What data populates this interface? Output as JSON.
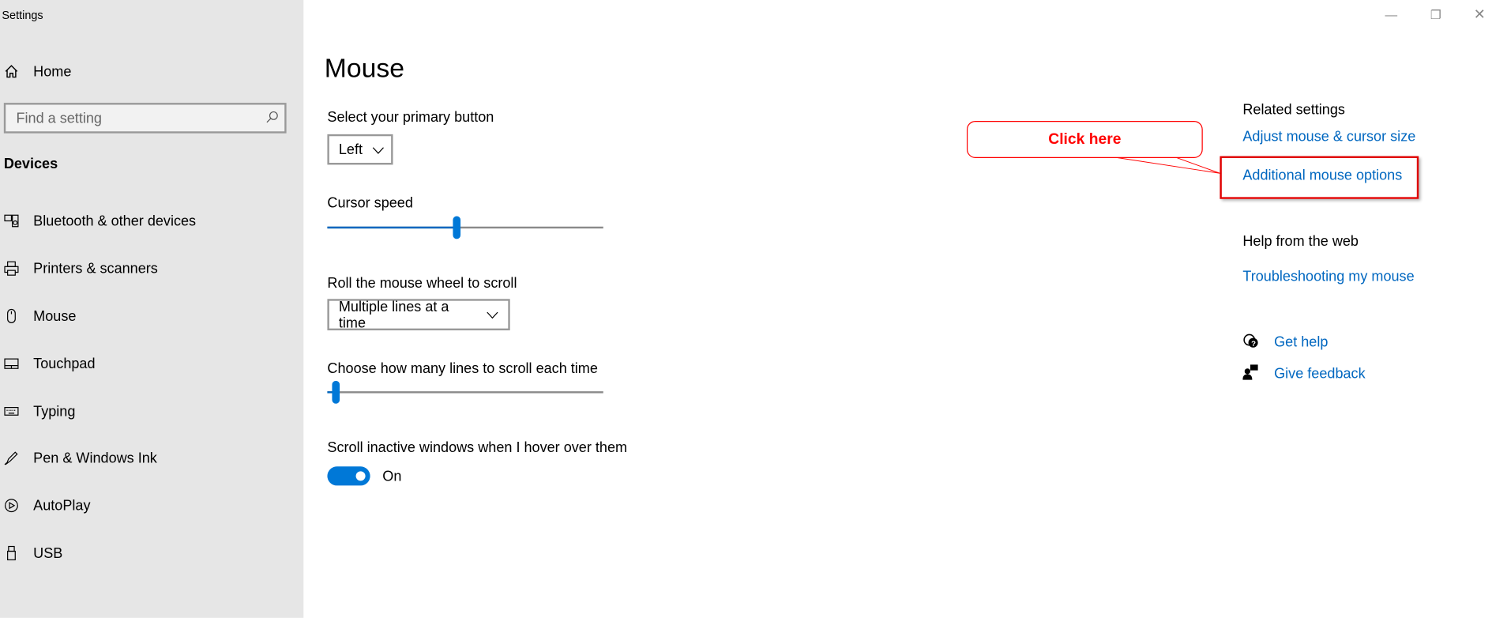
{
  "window": {
    "title": "Settings",
    "controls": [
      "minimize",
      "restore",
      "close"
    ]
  },
  "sidebar": {
    "home_label": "Home",
    "search_placeholder": "Find a setting",
    "section": "Devices",
    "items": [
      {
        "label": "Bluetooth & other devices",
        "icon": "bluetooth-devices-icon"
      },
      {
        "label": "Printers & scanners",
        "icon": "printer-icon"
      },
      {
        "label": "Mouse",
        "icon": "mouse-icon"
      },
      {
        "label": "Touchpad",
        "icon": "touchpad-icon"
      },
      {
        "label": "Typing",
        "icon": "keyboard-icon"
      },
      {
        "label": "Pen & Windows Ink",
        "icon": "pen-icon"
      },
      {
        "label": "AutoPlay",
        "icon": "autoplay-icon"
      },
      {
        "label": "USB",
        "icon": "usb-icon"
      }
    ]
  },
  "main": {
    "title": "Mouse",
    "primary_button": {
      "label": "Select your primary button",
      "value": "Left"
    },
    "cursor_speed": {
      "label": "Cursor speed",
      "fraction": 0.47
    },
    "wheel": {
      "label": "Roll the mouse wheel to scroll",
      "value": "Multiple lines at a time"
    },
    "lines": {
      "label": "Choose how many lines to scroll each time",
      "fraction": 0.03
    },
    "inactive": {
      "label": "Scroll inactive windows when I hover over them",
      "state": "On"
    }
  },
  "related": {
    "heading": "Related settings",
    "links": [
      "Adjust mouse & cursor size",
      "Additional mouse options"
    ],
    "help_heading": "Help from the web",
    "help_link": "Troubleshooting my mouse",
    "get_help": "Get help",
    "feedback": "Give feedback"
  },
  "annotation": {
    "callout": "Click here",
    "color": "#ff0000"
  },
  "colors": {
    "accent": "#0078d7",
    "link": "#0067c0",
    "sidebar": "#e6e6e6"
  }
}
